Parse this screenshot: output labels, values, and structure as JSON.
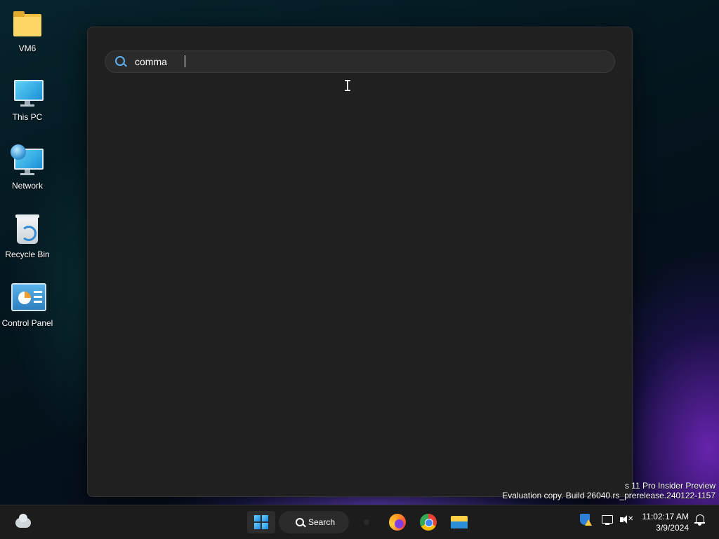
{
  "desktop": {
    "icons": [
      {
        "label": "VM6",
        "icon": "folder-icon"
      },
      {
        "label": "This PC",
        "icon": "computer-icon"
      },
      {
        "label": "Network",
        "icon": "network-icon"
      },
      {
        "label": "Recycle Bin",
        "icon": "recycle-bin-icon"
      },
      {
        "label": "Control Panel",
        "icon": "control-panel-icon"
      }
    ],
    "watermark": {
      "line1": "s 11 Pro Insider Preview",
      "line2": "Evaluation copy. Build 26040.rs_prerelease.240122-1157"
    }
  },
  "start_search": {
    "query": "comma",
    "icon": "search-icon",
    "accent": "#5fb2f2"
  },
  "taskbar": {
    "search_label": "Search",
    "pinned": [
      "start-icon",
      "firefox-icon",
      "chrome-icon",
      "file-explorer-icon"
    ],
    "tray": [
      "defender-warning-icon",
      "network-icon",
      "volume-muted-icon",
      "notification-bell-icon"
    ],
    "clock": {
      "time": "11:02:17 AM",
      "date": "3/9/2024"
    }
  }
}
